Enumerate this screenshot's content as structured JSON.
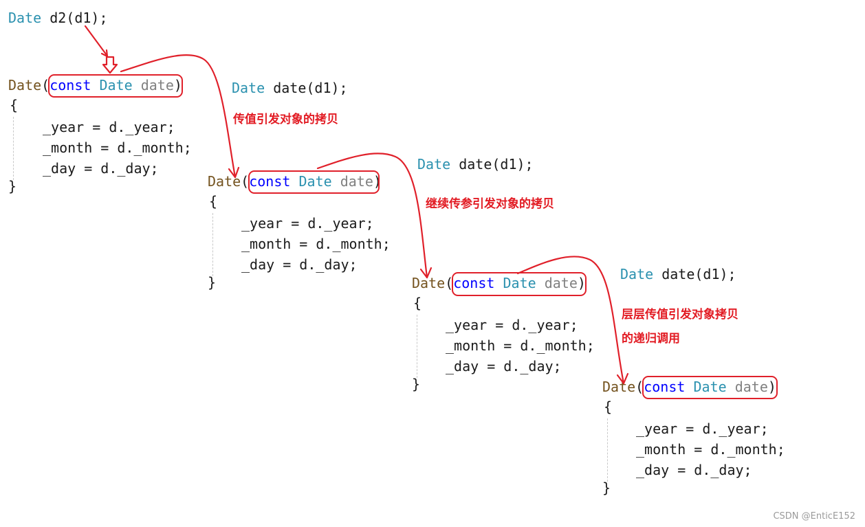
{
  "top_call": {
    "type": "Date",
    "rest": " d2(d1);"
  },
  "frames": [
    {
      "fn": "Date",
      "kw_const": "const",
      "type": "Date",
      "param": "date",
      "open": "{",
      "close": "}",
      "lines": [
        "_year = d._year;",
        "_month = d._month;",
        "_day = d._day;"
      ]
    },
    {
      "fn": "Date",
      "kw_const": "const",
      "type": "Date",
      "param": "date",
      "open": "{",
      "close": "}",
      "lines": [
        "_year = d._year;",
        "_month = d._month;",
        "_day = d._day;"
      ]
    },
    {
      "fn": "Date",
      "kw_const": "const",
      "type": "Date",
      "param": "date",
      "open": "{",
      "close": "}",
      "lines": [
        "_year = d._year;",
        "_month = d._month;",
        "_day = d._day;"
      ]
    },
    {
      "fn": "Date",
      "kw_const": "const",
      "type": "Date",
      "param": "date",
      "open": "{",
      "close": "}",
      "lines": [
        "_year = d._year;",
        "_month = d._month;",
        "_day = d._day;"
      ]
    }
  ],
  "side_calls": [
    {
      "type": "Date",
      "rest": " date(d1);"
    },
    {
      "type": "Date",
      "rest": " date(d1);"
    },
    {
      "type": "Date",
      "rest": " date(d1);"
    }
  ],
  "notes": [
    "传值引发对象的拷贝",
    "继续传参引发对象的拷贝",
    "层层传值引发对象拷贝",
    "的递归调用"
  ],
  "watermark": "CSDN @EnticE152",
  "colors": {
    "annotation_red": "#e21b23",
    "type_teal": "#2b91af",
    "keyword_blue": "#0000ff",
    "param_gray": "#808080",
    "function_brown": "#74531f"
  }
}
